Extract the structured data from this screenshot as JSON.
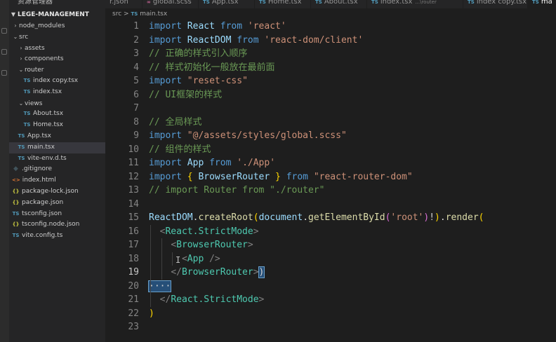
{
  "sidebar": {
    "header": "资源管理器",
    "project": "LEGE-MANAGEMENT",
    "tree": [
      {
        "label": "node_modules",
        "type": "folder",
        "expanded": false,
        "level": 1
      },
      {
        "label": "src",
        "type": "folder",
        "expanded": true,
        "level": 1
      },
      {
        "label": "assets",
        "type": "folder",
        "expanded": false,
        "level": 2
      },
      {
        "label": "components",
        "type": "folder",
        "expanded": false,
        "level": 2
      },
      {
        "label": "router",
        "type": "folder",
        "expanded": true,
        "level": 2
      },
      {
        "label": "index copy.tsx",
        "type": "ts",
        "level": 3
      },
      {
        "label": "index.tsx",
        "type": "ts",
        "level": 3
      },
      {
        "label": "views",
        "type": "folder",
        "expanded": true,
        "level": 2
      },
      {
        "label": "About.tsx",
        "type": "ts",
        "level": 3
      },
      {
        "label": "Home.tsx",
        "type": "ts",
        "level": 3
      },
      {
        "label": "App.tsx",
        "type": "ts",
        "level": 2
      },
      {
        "label": "main.tsx",
        "type": "ts",
        "level": 2,
        "selected": true
      },
      {
        "label": "vite-env.d.ts",
        "type": "ts",
        "level": 2
      },
      {
        "label": ".gitignore",
        "type": "git",
        "level": 1
      },
      {
        "label": "index.html",
        "type": "html",
        "level": 1
      },
      {
        "label": "package-lock.json",
        "type": "json",
        "level": 1
      },
      {
        "label": "package.json",
        "type": "json",
        "level": 1
      },
      {
        "label": "tsconfig.json",
        "type": "tsc",
        "level": 1
      },
      {
        "label": "tsconfig.node.json",
        "type": "json",
        "level": 1
      },
      {
        "label": "vite.config.ts",
        "type": "cfg",
        "level": 1
      }
    ]
  },
  "tabs": [
    {
      "label": "r.json",
      "icon": ""
    },
    {
      "label": "global.scss",
      "icon": "",
      "icon_color": "#cd6799"
    },
    {
      "label": "App.tsx",
      "icon": "TS"
    },
    {
      "label": "Home.tsx",
      "icon": "TS"
    },
    {
      "label": "About.tsx",
      "icon": "TS"
    },
    {
      "label": "index.tsx",
      "icon": "TS",
      "hint": "...\\router"
    },
    {
      "label": "index copy.tsx",
      "icon": "TS"
    },
    {
      "label": "ma",
      "icon": "TS",
      "active": true
    }
  ],
  "breadcrumb": {
    "folder": "src",
    "sep": ">",
    "icon": "TS",
    "file": "main.tsx"
  },
  "editor": {
    "current_line": 19,
    "lines": [
      [
        [
          "k",
          "import"
        ],
        [
          "p",
          " "
        ],
        [
          "v",
          "React"
        ],
        [
          "p",
          " "
        ],
        [
          "k",
          "from"
        ],
        [
          "p",
          " "
        ],
        [
          "s",
          "'react'"
        ]
      ],
      [
        [
          "k",
          "import"
        ],
        [
          "p",
          " "
        ],
        [
          "v",
          "ReactDOM"
        ],
        [
          "p",
          " "
        ],
        [
          "k",
          "from"
        ],
        [
          "p",
          " "
        ],
        [
          "s",
          "'react-dom/client'"
        ]
      ],
      [
        [
          "c",
          "// 正确的样式引入顺序"
        ]
      ],
      [
        [
          "c",
          "// 样式初始化一般放在最前面"
        ]
      ],
      [
        [
          "k",
          "import"
        ],
        [
          "p",
          " "
        ],
        [
          "s",
          "\"reset-css\""
        ]
      ],
      [
        [
          "c",
          "// UI框架的样式"
        ]
      ],
      [],
      [
        [
          "c",
          "// 全局样式"
        ]
      ],
      [
        [
          "k",
          "import"
        ],
        [
          "p",
          " "
        ],
        [
          "s",
          "\"@/assets/styles/global.scss\""
        ]
      ],
      [
        [
          "c",
          "// 组件的样式"
        ]
      ],
      [
        [
          "k",
          "import"
        ],
        [
          "p",
          " "
        ],
        [
          "v",
          "App"
        ],
        [
          "p",
          " "
        ],
        [
          "k",
          "from"
        ],
        [
          "p",
          " "
        ],
        [
          "s",
          "'./App'"
        ]
      ],
      [
        [
          "k",
          "import"
        ],
        [
          "p",
          " "
        ],
        [
          "b1",
          "{"
        ],
        [
          "p",
          " "
        ],
        [
          "v",
          "BrowserRouter"
        ],
        [
          "p",
          " "
        ],
        [
          "b1",
          "}"
        ],
        [
          "p",
          " "
        ],
        [
          "k",
          "from"
        ],
        [
          "p",
          " "
        ],
        [
          "s",
          "\"react-router-dom\""
        ]
      ],
      [
        [
          "c",
          "// import Router from \"./router\""
        ]
      ],
      [],
      [
        [
          "v",
          "ReactDOM"
        ],
        [
          "p",
          "."
        ],
        [
          "f",
          "createRoot"
        ],
        [
          "b1",
          "("
        ],
        [
          "v",
          "document"
        ],
        [
          "p",
          "."
        ],
        [
          "f",
          "getElementById"
        ],
        [
          "b2",
          "("
        ],
        [
          "s",
          "'root'"
        ],
        [
          "b2",
          ")"
        ],
        [
          "p",
          "!"
        ],
        [
          "b1",
          ")"
        ],
        [
          "p",
          "."
        ],
        [
          "f",
          "render"
        ],
        [
          "b1",
          "("
        ]
      ],
      [
        [
          "p",
          "  "
        ],
        [
          "tg",
          "<"
        ],
        [
          "cn",
          "React.StrictMode"
        ],
        [
          "tg",
          ">"
        ]
      ],
      [
        [
          "p",
          "    "
        ],
        [
          "tg",
          "<"
        ],
        [
          "cn",
          "BrowserRouter"
        ],
        [
          "tg",
          ">"
        ]
      ],
      [
        [
          "p",
          "      "
        ],
        [
          "tg",
          "<"
        ],
        [
          "cn",
          "App"
        ],
        [
          "p",
          " "
        ],
        [
          "tg",
          "/>"
        ]
      ],
      [
        [
          "p",
          "    "
        ],
        [
          "tg",
          "</"
        ],
        [
          "cn",
          "BrowserRouter"
        ],
        [
          "tg",
          ">"
        ],
        [
          "bm",
          ")"
        ]
      ],
      [
        [
          "bm",
          "····"
        ]
      ],
      [
        [
          "p",
          "  "
        ],
        [
          "tg",
          "</"
        ],
        [
          "cn",
          "React.StrictMode"
        ],
        [
          "tg",
          ">"
        ]
      ],
      [
        [
          "b1",
          ")"
        ]
      ],
      []
    ]
  },
  "colors": {
    "editor_bg": "#1e1e1e",
    "sidebar_bg": "#252526",
    "comment": "#6a9955",
    "keyword": "#569cd6",
    "string": "#ce9178",
    "type": "#4ec9b0"
  }
}
